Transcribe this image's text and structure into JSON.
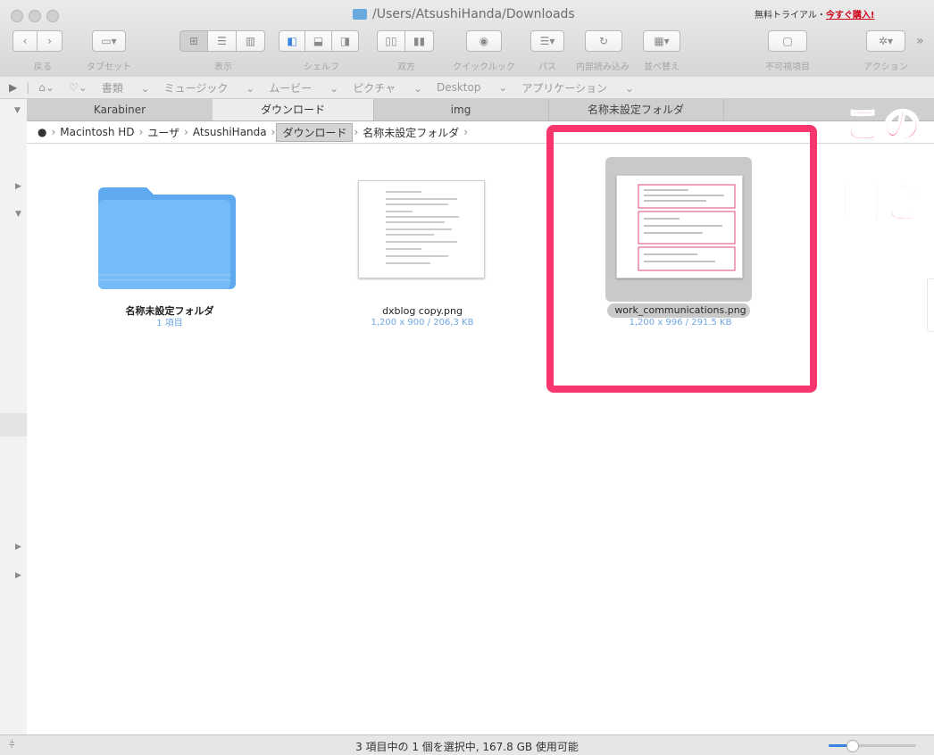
{
  "window": {
    "path_title": "/Users/AtsushiHanda/Downloads",
    "trial_text": "無料トライアル・",
    "buy_text": "今すぐ購入!"
  },
  "toolbar": {
    "labels": [
      "戻る",
      "タブセット",
      "表示",
      "シェルフ",
      "双方",
      "クイックルック",
      "パス",
      "内部読み込み",
      "並べ替え",
      "不可視項目",
      "アクション"
    ],
    "more": "»"
  },
  "favorites": {
    "items": [
      "書類",
      "ミュージック",
      "ムービー",
      "ピクチャ",
      "Desktop",
      "アプリケーション"
    ]
  },
  "tabs": [
    "Karabiner",
    "ダウンロード",
    "img",
    "名称未設定フォルダ"
  ],
  "breadcrumb": [
    "Macintosh HD",
    "ユーザ",
    "AtsushiHanda",
    "ダウンロード",
    "名称未設定フォルダ"
  ],
  "items": [
    {
      "name": "名称未設定フォルダ",
      "sub": "1 項目"
    },
    {
      "name": "dxblog copy.png",
      "sub": "1,200 x 900 / 206,3 KB"
    },
    {
      "name": "work_communications.png",
      "sub": "1,200 x 996 / 291.5 KB"
    }
  ],
  "annotation": {
    "line1": "この",
    "line2": "開き"
  },
  "status": {
    "text": "3 項目中の 1 個を選択中, 167.8 GB 使用可能"
  },
  "colors": {
    "accent": "#f7366d",
    "folder": "#6ab4f5",
    "subtext": "#6fa8e6"
  }
}
